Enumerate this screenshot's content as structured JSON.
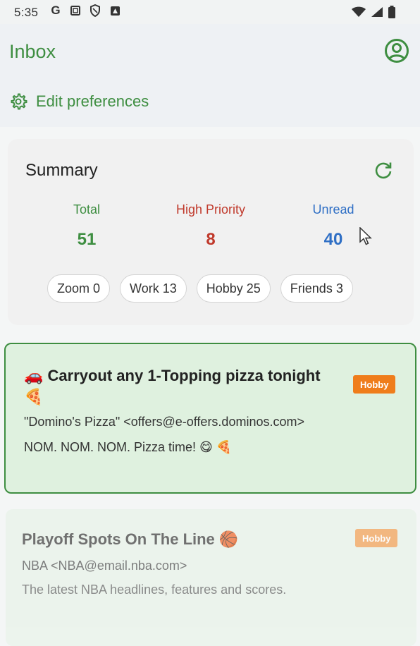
{
  "status_bar": {
    "time": "5:35",
    "left_icons": [
      "google-icon",
      "screenshot-icon",
      "shield-icon",
      "app-icon"
    ],
    "right_icons": [
      "wifi-icon",
      "signal-icon",
      "battery-icon"
    ]
  },
  "header": {
    "title": "Inbox",
    "account_icon": "account-circle-icon",
    "edit_preferences_label": "Edit preferences"
  },
  "summary": {
    "title": "Summary",
    "stats": [
      {
        "label": "Total",
        "value": "51",
        "color": "#3e8e41"
      },
      {
        "label": "High Priority",
        "value": "8",
        "color": "#c0392b"
      },
      {
        "label": "Unread",
        "value": "40",
        "color": "#2f6fc5"
      }
    ],
    "chips": [
      "Zoom 0",
      "Work 13",
      "Hobby 25",
      "Friends 3"
    ]
  },
  "emails": [
    {
      "subject": "🚗 Carryout any 1-Topping pizza tonight 🍕",
      "badge": "Hobby",
      "from": "\"Domino's Pizza\" <offers@e-offers.dominos.com>",
      "snippet": "NOM. NOM. NOM. Pizza time! 😋 🍕"
    },
    {
      "subject": "Playoff Spots On The Line 🏀",
      "badge": "Hobby",
      "from": "NBA <NBA@email.nba.com>",
      "snippet": "The latest NBA headlines, features and scores."
    }
  ],
  "colors": {
    "accent_green": "#3e8e41",
    "priority_red": "#c0392b",
    "unread_blue": "#2f6fc5",
    "badge_orange": "#ef7d1b"
  }
}
